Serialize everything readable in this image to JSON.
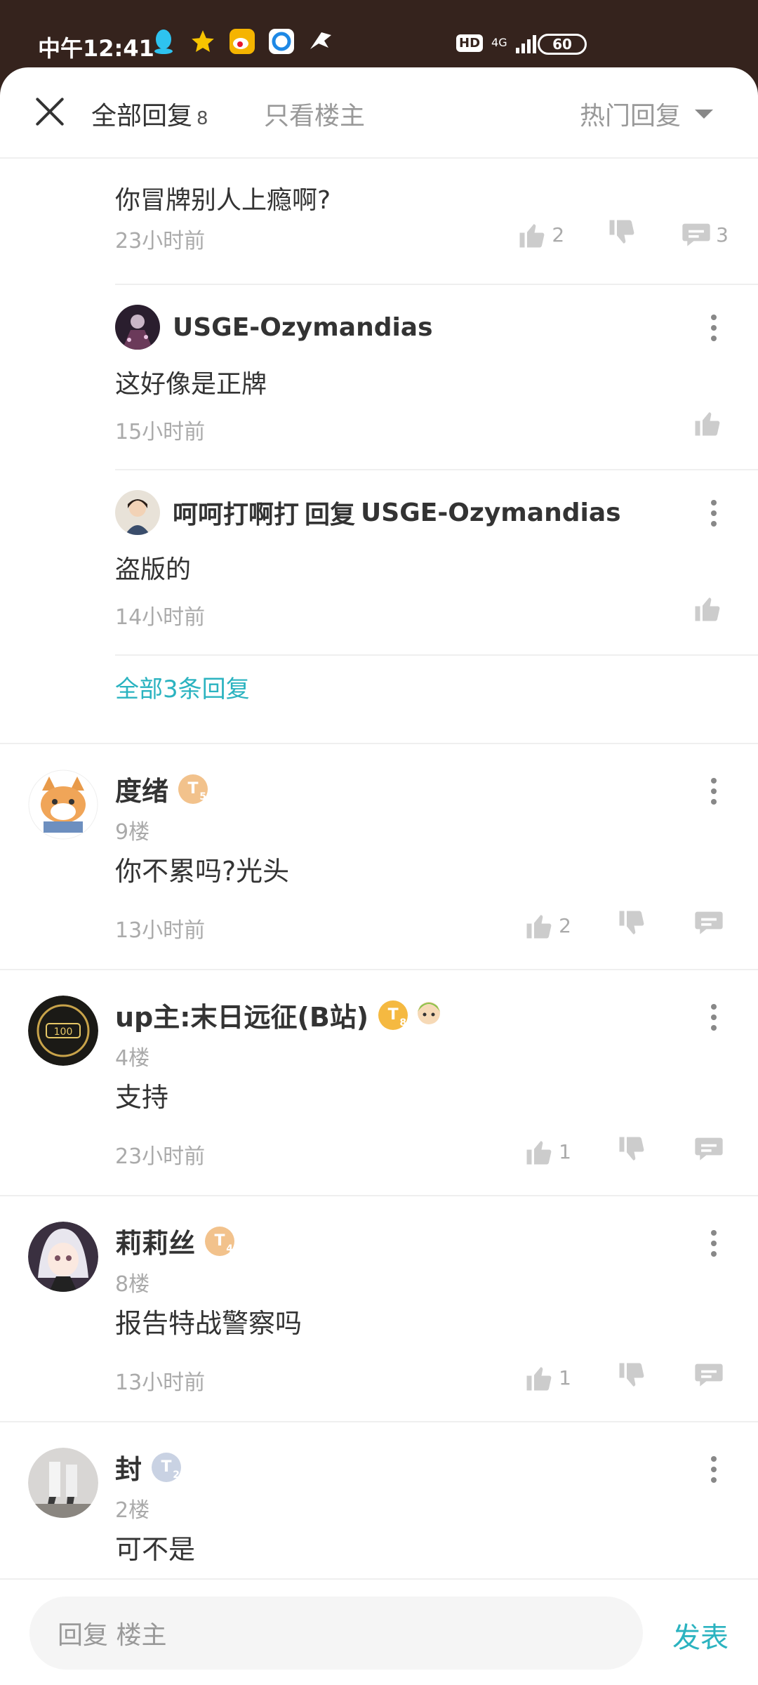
{
  "status_bar": {
    "time": "中午12:41",
    "hd": "HD",
    "network": "4G",
    "battery": "60"
  },
  "header": {
    "tab_all_label": "全部回复",
    "tab_all_count": "8",
    "tab_op_label": "只看楼主",
    "sort_label": "热门回复"
  },
  "sub_replies": [
    {
      "text": "你冒牌别人上瘾啊?",
      "time": "23小时前",
      "likes": "2",
      "replies": "3"
    },
    {
      "user": "USGE-Ozymandias",
      "text": "这好像是正牌",
      "time": "15小时前"
    },
    {
      "user": "呵呵打啊打",
      "reply_word": "回复",
      "reply_to": "USGE-Ozymandias",
      "text": "盗版的",
      "time": "14小时前"
    }
  ],
  "view_all_label": "全部3条回复",
  "comments": [
    {
      "name": "度绪",
      "badge": "T",
      "badge_level": "5",
      "badge_color": "#f2c28c",
      "floor": "9楼",
      "text": "你不累吗?光头",
      "time": "13小时前",
      "likes": "2"
    },
    {
      "name": "up主:末日远征(B站)",
      "badge": "T",
      "badge_level": "8",
      "badge_color": "#f5b941",
      "floor": "4楼",
      "text": "支持",
      "time": "23小时前",
      "likes": "1"
    },
    {
      "name": "莉莉丝",
      "badge": "T",
      "badge_level": "4",
      "badge_color": "#f2c28c",
      "floor": "8楼",
      "text": "报告特战警察吗",
      "time": "13小时前",
      "likes": "1"
    },
    {
      "name": "封",
      "badge": "T",
      "badge_level": "2",
      "badge_color": "#c9d2e3",
      "floor": "2楼",
      "text": "可不是"
    }
  ],
  "bottom": {
    "input_placeholder": "回复 楼主",
    "send_label": "发表"
  },
  "colors": {
    "accent": "#2bb3c0",
    "status_bar_bg": "#35231d"
  }
}
